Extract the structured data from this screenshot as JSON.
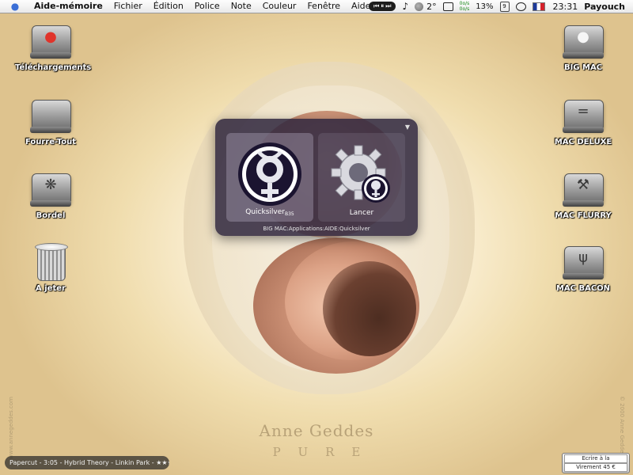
{
  "menubar": {
    "apple_icon": "apple-icon",
    "items": [
      "Aide-mémoire",
      "Fichier",
      "Édition",
      "Police",
      "Note",
      "Couleur",
      "Fenêtre",
      "Aide"
    ],
    "player_controls": [
      "⏮",
      "⏸",
      "⏭"
    ],
    "temperature": "2°",
    "net_up": "0o/s",
    "net_down": "0o/s",
    "cpu": "13%",
    "flag": "fr",
    "clock": "23:31",
    "user": "Payouch"
  },
  "desktop_icons": {
    "left": [
      {
        "label": "Téléchargements",
        "icon": "apple-rainbow-drive-icon"
      },
      {
        "label": "Fourre-Tout",
        "icon": "hard-drive-icon"
      },
      {
        "label": "Bordel",
        "icon": "paw-drive-icon"
      },
      {
        "label": "A jeter",
        "icon": "trash-icon"
      }
    ],
    "right": [
      {
        "label": "BIG MAC",
        "icon": "apple-drive-icon"
      },
      {
        "label": "MAC DELUXE",
        "icon": "hard-drive-icon"
      },
      {
        "label": "MAC FLURRY",
        "icon": "tools-drive-icon"
      },
      {
        "label": "MAC BACON",
        "icon": "usb-drive-icon"
      }
    ]
  },
  "quicksilver": {
    "selected_item": "Quicksilver",
    "selected_version": "B35",
    "action": "Lancer",
    "path": "BIG MAC:Applications:AIDE:Quicksilver"
  },
  "wallpaper": {
    "brand": "Anne Geddes",
    "brand_sub": "PURE",
    "site": "www.annegeddes.com",
    "copyright": "© 2000 Anne Geddes"
  },
  "now_playing": {
    "text": "Papercut - 3:05 - Hybrid Theory - Linkin Park - ★★★★"
  },
  "widget": {
    "button_top": "Ecrire à la",
    "button_bottom": "Virement 45 €"
  }
}
